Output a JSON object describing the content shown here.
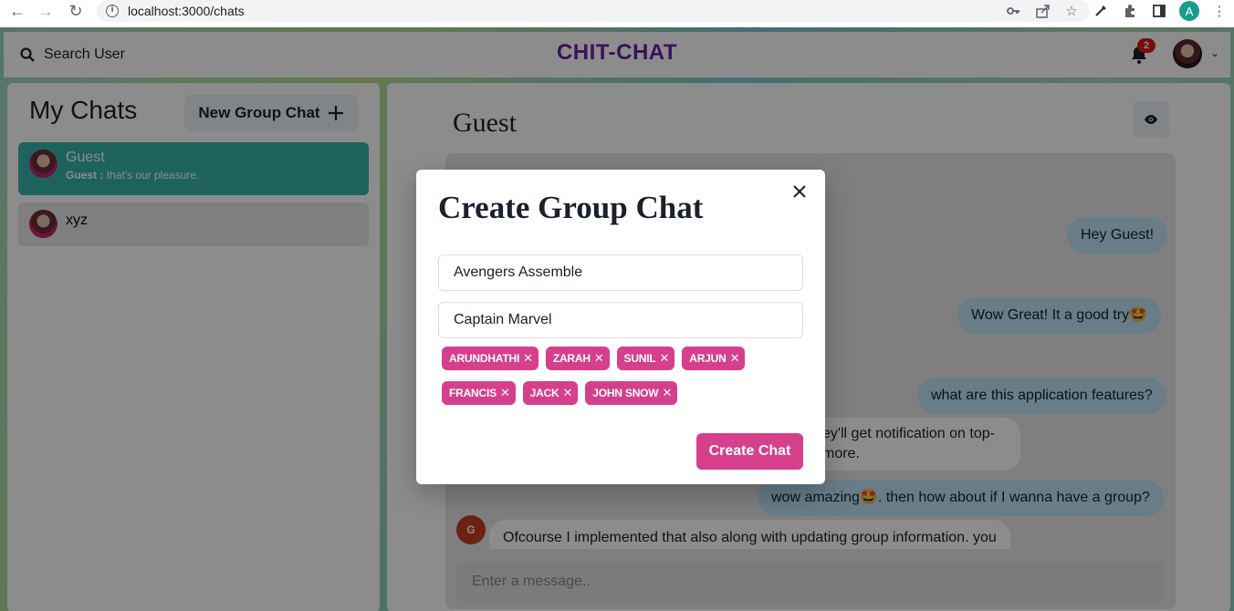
{
  "browser": {
    "url": "localhost:3000/chats",
    "profile_initial": "A"
  },
  "header": {
    "search_label": "Search User",
    "app_title": "CHIT-CHAT",
    "notification_count": "2"
  },
  "sidebar": {
    "title": "My Chats",
    "new_group_label": "New Group Chat",
    "chats": [
      {
        "name": "Guest",
        "last_sender": "Guest :",
        "last_message": "that's our pleasure."
      },
      {
        "name": "xyz"
      }
    ]
  },
  "chat": {
    "title": "Guest",
    "sender_initial": "G",
    "messages": [
      {
        "text": "Hey Guest!"
      },
      {
        "text": "Wow Great! It a good try🤩"
      },
      {
        "text": "what are this application features?"
      },
      {
        "text": "ey'll get notification on top-"
      },
      {
        "text": "more."
      },
      {
        "text": "wow amazing🤩. then how about if I wanna have a group?"
      },
      {
        "text": "Ofcourse I implemented that also along with updating group information. you"
      }
    ],
    "input_placeholder": "Enter a message.."
  },
  "modal": {
    "title": "Create Group Chat",
    "chat_name_value": "Avengers Assemble",
    "search_value": "Captain Marvel",
    "tags": [
      "ARUNDHATHI",
      "ZARAH",
      "SUNIL",
      "ARJUN",
      "FRANCIS",
      "JACK",
      "JOHN SNOW"
    ],
    "create_label": "Create Chat"
  },
  "colors": {
    "accent_pink": "#d53f8c",
    "teal": "#38b2ac",
    "title_purple": "#6b1fa8"
  }
}
